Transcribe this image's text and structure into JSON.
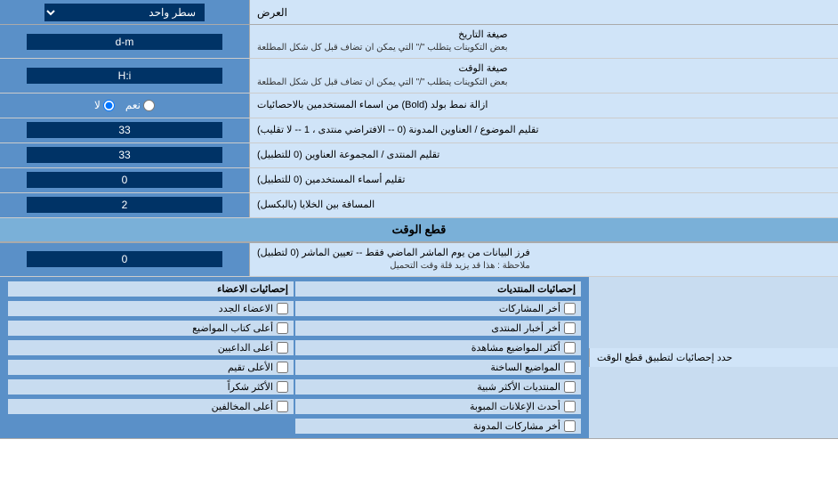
{
  "header": {
    "display_label": "العرض",
    "line_option": "سطر واحد"
  },
  "date_format": {
    "label": "صيغة التاريخ",
    "sublabel": "بعض التكوينات يتطلب \"/\" التي يمكن ان تضاف قبل كل شكل المطلعة",
    "value": "d-m"
  },
  "time_format": {
    "label": "صيغة الوقت",
    "sublabel": "بعض التكوينات يتطلب \"/\" التي يمكن ان تضاف قبل كل شكل المطلعة",
    "value": "H:i"
  },
  "bold_label": {
    "label": "ازالة نمط بولد (Bold) من اسماء المستخدمين بالاحصائيات",
    "option_yes": "نعم",
    "option_no": "لا",
    "selected": "no"
  },
  "topic_sorting": {
    "label": "تقليم الموضوع / العناوين المدونة (0 -- الافتراضي منتدى ، 1 -- لا تقليب)",
    "value": "33"
  },
  "forum_sorting": {
    "label": "تقليم المنتدى / المجموعة العناوين (0 للتطبيل)",
    "value": "33"
  },
  "user_names": {
    "label": "تقليم أسماء المستخدمين (0 للتطبيل)",
    "value": "0"
  },
  "cell_spacing": {
    "label": "المسافة بين الخلايا (بالبكسل)",
    "value": "2"
  },
  "cutoff_section": {
    "title": "قطع الوقت"
  },
  "cutoff_value": {
    "label_line1": "فرز البيانات من يوم الماشر الماضي فقط -- تعيين الماشر (0 لتطبيل)",
    "label_line2": "ملاحظة : هذا قد يزيد قلة وقت التحميل",
    "value": "0"
  },
  "stats_apply": {
    "label": "حدد إحصائيات لتطبيق قطع الوقت"
  },
  "checkboxes": {
    "col1_title": "إحصائيات المنتديات",
    "col2_title": "إحصائيات الاعضاء",
    "col1_items": [
      {
        "label": "أخر المشاركات",
        "checked": false
      },
      {
        "label": "أخر أخبار المنتدى",
        "checked": false
      },
      {
        "label": "أكثر المواضيع مشاهدة",
        "checked": false
      },
      {
        "label": "المواضيع الساخنة",
        "checked": false
      },
      {
        "label": "المنتديات الأكثر شبية",
        "checked": false
      },
      {
        "label": "أحدث الإعلانات المبوبة",
        "checked": false
      },
      {
        "label": "أخر مشاركات المدونة",
        "checked": false
      }
    ],
    "col2_items": [
      {
        "label": "الاعضاء الجدد",
        "checked": false
      },
      {
        "label": "أعلى كتاب المواضيع",
        "checked": false
      },
      {
        "label": "أعلى الداعيين",
        "checked": false
      },
      {
        "label": "الأعلى تقيم",
        "checked": false
      },
      {
        "label": "الأكثر شكراً",
        "checked": false
      },
      {
        "label": "أعلى المخالفين",
        "checked": false
      }
    ]
  }
}
